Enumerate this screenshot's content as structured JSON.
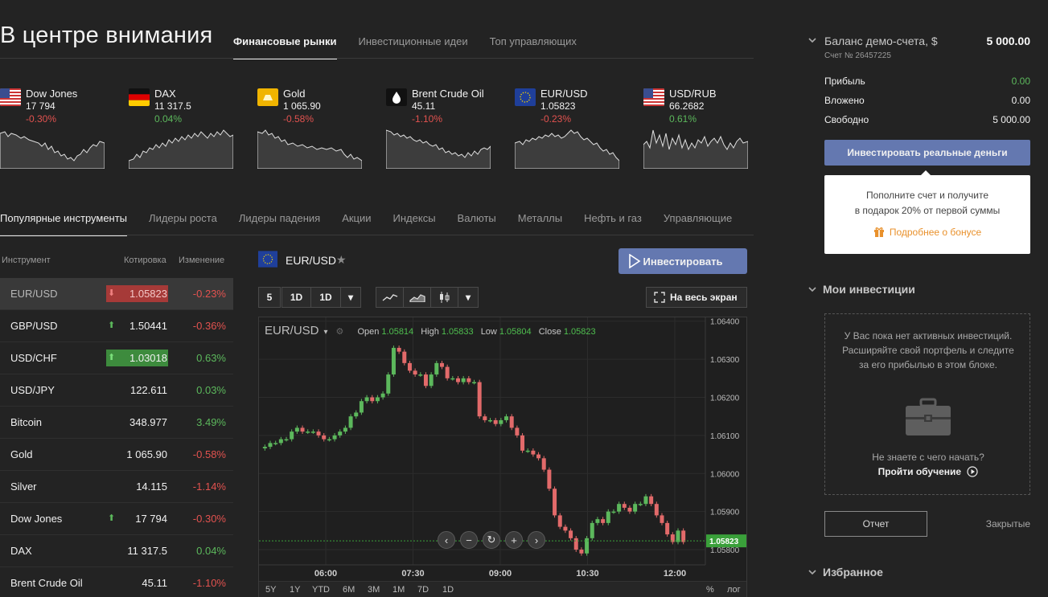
{
  "header": {
    "title": "В центре внимания",
    "tabs": [
      "Финансовые рынки",
      "Инвестиционные идеи",
      "Топ управляющих"
    ]
  },
  "tickers": [
    {
      "name": "Dow Jones",
      "price": "17 794",
      "change": "-0.30%",
      "dir": "down",
      "flag": "us-flag-icon"
    },
    {
      "name": "DAX",
      "price": "11 317.5",
      "change": "0.04%",
      "dir": "up",
      "flag": "germany-flag-icon"
    },
    {
      "name": "Gold",
      "price": "1 065.90",
      "change": "-0.58%",
      "dir": "down",
      "flag": "gold-bar-icon"
    },
    {
      "name": "Brent Crude Oil",
      "price": "45.11",
      "change": "-1.10%",
      "dir": "down",
      "flag": "oil-drop-icon"
    },
    {
      "name": "EUR/USD",
      "price": "1.05823",
      "change": "-0.23%",
      "dir": "down",
      "flag": "eu-flag-icon"
    },
    {
      "name": "USD/RUB",
      "price": "66.2682",
      "change": "0.61%",
      "dir": "up",
      "flag": "us-flag-icon"
    }
  ],
  "categories": [
    "Популярные инструменты",
    "Лидеры роста",
    "Лидеры падения",
    "Акции",
    "Индексы",
    "Валюты",
    "Металлы",
    "Нефть и газ",
    "Управляющие"
  ],
  "instruments": {
    "headers": [
      "Инструмент",
      "Котировка",
      "Изменение"
    ],
    "rows": [
      {
        "name": "EUR/USD",
        "price": "1.05823",
        "change": "-0.23%",
        "dir": "down"
      },
      {
        "name": "GBP/USD",
        "price": "1.50441",
        "change": "-0.36%",
        "dir": "down"
      },
      {
        "name": "USD/CHF",
        "price": "1.03018",
        "change": "0.63%",
        "dir": "up"
      },
      {
        "name": "USD/JPY",
        "price": "122.611",
        "change": "0.03%",
        "dir": "up"
      },
      {
        "name": "Bitcoin",
        "price": "348.977",
        "change": "3.49%",
        "dir": "up"
      },
      {
        "name": "Gold",
        "price": "1 065.90",
        "change": "-0.58%",
        "dir": "down"
      },
      {
        "name": "Silver",
        "price": "14.115",
        "change": "-1.14%",
        "dir": "down"
      },
      {
        "name": "Dow Jones",
        "price": "17 794",
        "change": "-0.30%",
        "dir": "down"
      },
      {
        "name": "DAX",
        "price": "11 317.5",
        "change": "0.04%",
        "dir": "up"
      },
      {
        "name": "Brent Crude Oil",
        "price": "45.11",
        "change": "-1.10%",
        "dir": "down"
      }
    ]
  },
  "chart_panel": {
    "symbol": "EUR/USD",
    "star": "★",
    "invest_label": "Инвестировать",
    "fullscreen_label": "На весь экран",
    "toolbar": {
      "interval": "5",
      "range1": "1D",
      "range2": "1D",
      "dropdown": "▾"
    },
    "ohlc": {
      "symbol": "EUR/USD",
      "open_label": "Open",
      "open": "1.05814",
      "high_label": "High",
      "high": "1.05833",
      "low_label": "Low",
      "low": "1.05804",
      "close_label": "Close",
      "close": "1.05823"
    },
    "ranges": [
      "5Y",
      "1Y",
      "YTD",
      "6M",
      "3M",
      "1M",
      "7D",
      "1D"
    ],
    "range_right": [
      "%",
      "лог"
    ],
    "colors": {
      "up": "#5cb85c",
      "down": "#e26a6a",
      "last_price": "#3aa03a"
    }
  },
  "chart_data": {
    "type": "candlestick",
    "symbol": "EUR/USD",
    "x_ticks": [
      "06:00",
      "07:30",
      "09:00",
      "10:30",
      "12:00"
    ],
    "y_ticks": [
      "1.06400",
      "1.06300",
      "1.06200",
      "1.06100",
      "1.06000",
      "1.05900",
      "1.05800"
    ],
    "ylim": [
      1.0576,
      1.0641
    ],
    "last_price": "1.05823",
    "closes": [
      1.0607,
      1.0608,
      1.0608,
      1.0609,
      1.0609,
      1.0611,
      1.0612,
      1.0611,
      1.0611,
      1.0611,
      1.061,
      1.0609,
      1.0609,
      1.061,
      1.0611,
      1.0612,
      1.0615,
      1.0616,
      1.0619,
      1.062,
      1.0619,
      1.062,
      1.0621,
      1.0626,
      1.0633,
      1.0632,
      1.0629,
      1.0627,
      1.0626,
      1.0626,
      1.0623,
      1.0626,
      1.0629,
      1.0628,
      1.0625,
      1.0625,
      1.0624,
      1.0625,
      1.0624,
      1.0624,
      1.0615,
      1.0614,
      1.0614,
      1.0613,
      1.0614,
      1.0615,
      1.0612,
      1.061,
      1.0606,
      1.0606,
      1.0605,
      1.0604,
      1.0601,
      1.0596,
      1.0589,
      1.0586,
      1.0585,
      1.0583,
      1.058,
      1.0579,
      1.0583,
      1.0587,
      1.0588,
      1.0587,
      1.059,
      1.059,
      1.0592,
      1.0591,
      1.059,
      1.0592,
      1.0592,
      1.0594,
      1.0592,
      1.0589,
      1.0587,
      1.0584,
      1.0582,
      1.0585,
      1.0582
    ]
  },
  "right": {
    "balance_label": "Баланс демо-счета, $",
    "balance_value": "5 000.00",
    "account": "Счет № 26457225",
    "rows": [
      {
        "label": "Прибыль",
        "value": "0.00",
        "color": "#5cb85c"
      },
      {
        "label": "Вложено",
        "value": "0.00",
        "color": "#f0f0f0"
      },
      {
        "label": "Свободно",
        "value": "5 000.00",
        "color": "#f0f0f0"
      }
    ],
    "real_money_button": "Инвестировать реальные деньги",
    "bonus_line1": "Пополните счет и получите",
    "bonus_line2": "в подарок 20% от первой суммы",
    "bonus_link": "Подробнее о бонусе",
    "my_investments": "Мои инвестиции",
    "empty_message": "У Вас пока нет активных инвестиций. Расширяйте свой портфель и следите за его прибылью в этом блоке.",
    "empty_question": "Не знаете с чего начать?",
    "learn_link": "Пройти обучение",
    "report_button": "Отчет",
    "closed_link": "Закрытые",
    "favorites": "Избранное"
  }
}
